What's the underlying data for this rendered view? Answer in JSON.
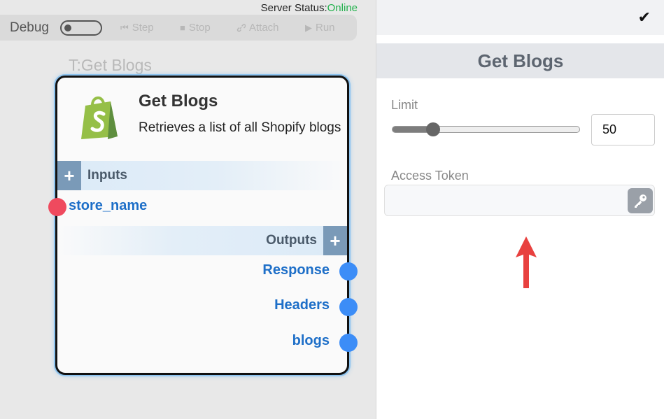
{
  "server_status": {
    "label": "Server Status:",
    "value": "Online",
    "color": "#22b14c"
  },
  "toolbar": {
    "debug_label": "Debug",
    "debug_enabled": false,
    "buttons": [
      {
        "label": "Step",
        "icon": "step-icon",
        "glyph": "⏮"
      },
      {
        "label": "Stop",
        "icon": "stop-icon",
        "glyph": "■"
      },
      {
        "label": "Attach",
        "icon": "link-icon",
        "glyph": "🔗"
      },
      {
        "label": "Run",
        "icon": "play-icon",
        "glyph": "▶"
      }
    ]
  },
  "node": {
    "type_title": "T:Get Blogs",
    "title": "Get Blogs",
    "description": "Retrieves a list of all Shopify blogs",
    "logo_icon": "shopify-logo-icon",
    "inputs_label": "Inputs",
    "outputs_label": "Outputs",
    "inputs": [
      {
        "name": "store_name",
        "color": "#ef4a5e"
      }
    ],
    "outputs": [
      {
        "name": "Response",
        "color": "#3c8df7"
      },
      {
        "name": "Headers",
        "color": "#3c8df7"
      },
      {
        "name": "blogs",
        "color": "#3c8df7"
      }
    ]
  },
  "panel": {
    "confirm_icon": "checkmark-icon",
    "title": "Get Blogs",
    "limit": {
      "label": "Limit",
      "value": "50",
      "slider_fraction": 0.22
    },
    "access_token": {
      "label": "Access Token",
      "value": "",
      "placeholder": "",
      "button_icon": "key-icon"
    },
    "annotation": {
      "icon": "red-up-arrow-icon",
      "color": "#e8413f"
    }
  }
}
